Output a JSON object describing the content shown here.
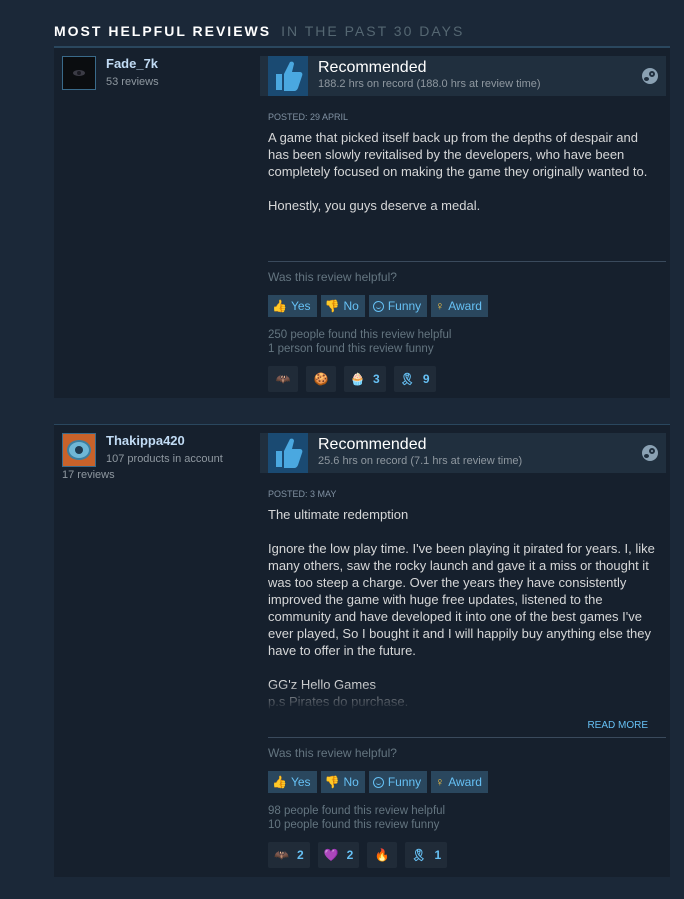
{
  "section": {
    "title": "Most Helpful Reviews",
    "subtitle": "In the past 30 days"
  },
  "reviews": [
    {
      "author": "Fade_7k",
      "products": "",
      "review_count": "53 reviews",
      "recommendation": "Recommended",
      "hours": "188.2 hrs on record (188.0 hrs at review time)",
      "posted": "Posted: 29 April",
      "text": "A game that picked itself back up from the depths of despair and has been slowly revitalised by the developers, who have been completely focused on making the game they originally wanted to.\n\nHonestly, you guys deserve a medal.",
      "helpful_question": "Was this review helpful?",
      "buttons": {
        "yes": "Yes",
        "no": "No",
        "funny": "Funny",
        "award": "Award"
      },
      "helpful_count": "250 people found this review helpful",
      "funny_count": "1 person found this review funny",
      "awards": [
        {
          "icon": "wings-award-icon",
          "count": ""
        },
        {
          "icon": "hot-take-award-icon",
          "count": ""
        },
        {
          "icon": "wholesome-award-icon",
          "count": "3"
        },
        {
          "icon": "ribbon-award-icon",
          "count": "9"
        }
      ]
    },
    {
      "author": "Thakippa420",
      "products": "107 products in account",
      "review_count": "17 reviews",
      "recommendation": "Recommended",
      "hours": "25.6 hrs on record (7.1 hrs at review time)",
      "posted": "Posted: 3 May",
      "text": "The ultimate redemption\n\nIgnore the low play time. I've been playing it pirated for years. I, like many others, saw the rocky launch and gave it a miss or thought it was too steep a charge. Over the years they have consistently improved the game with huge free updates, listened to the community and have developed it into one of the best games I've ever played, So I bought it and I will happily buy anything else they have to offer in the future.\n\nGG'z Hello Games\np.s Pirates do purchase.",
      "read_more": "Read More",
      "helpful_question": "Was this review helpful?",
      "buttons": {
        "yes": "Yes",
        "no": "No",
        "funny": "Funny",
        "award": "Award"
      },
      "helpful_count": "98 people found this review helpful",
      "funny_count": "10 people found this review funny",
      "awards": [
        {
          "icon": "wings-award-icon",
          "count": "2"
        },
        {
          "icon": "heart-award-icon",
          "count": "2"
        },
        {
          "icon": "fire-award-icon",
          "count": ""
        },
        {
          "icon": "ribbon-award-icon",
          "count": "1"
        }
      ]
    }
  ],
  "colors": {
    "background": "#1b2838",
    "panel": "#16202d",
    "accent": "#66c0f4",
    "thumb_bg": "#1a4a72"
  }
}
